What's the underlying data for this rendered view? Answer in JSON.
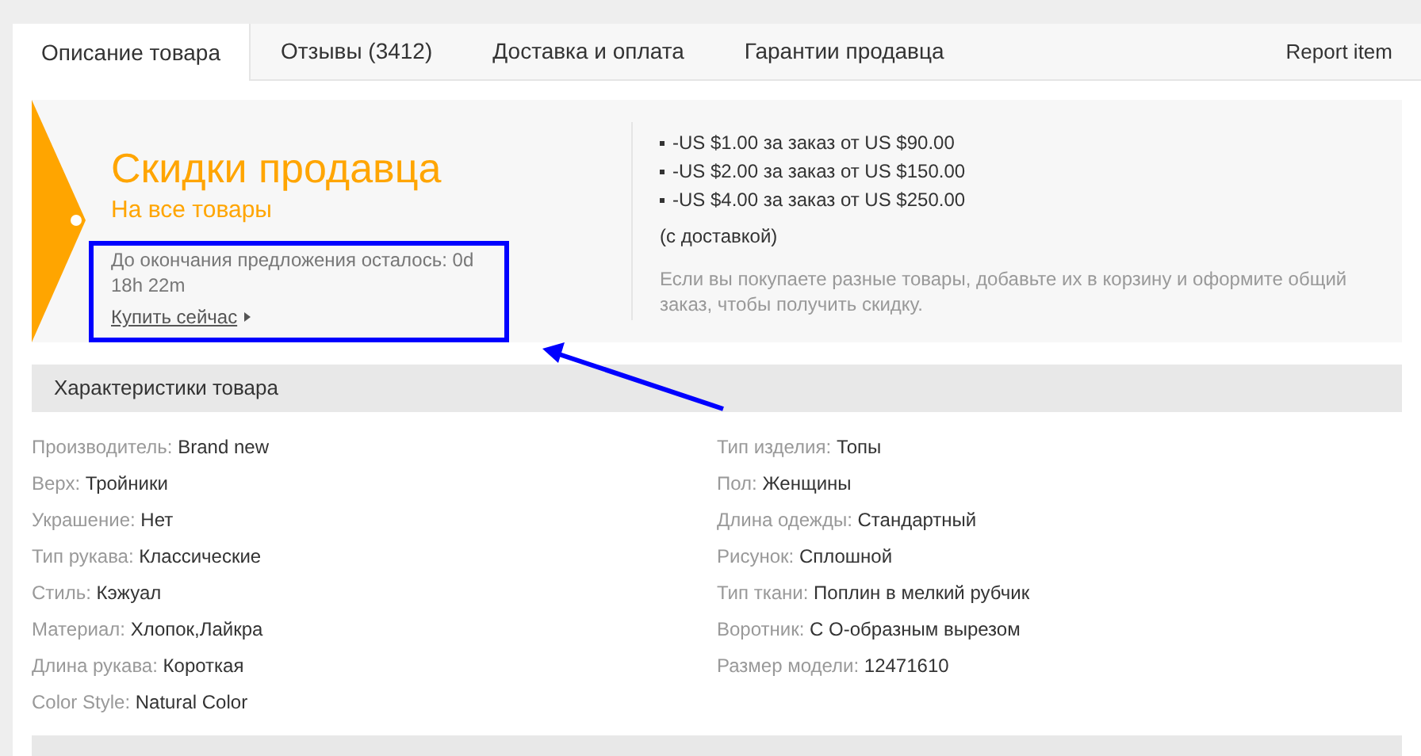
{
  "tabs": [
    {
      "label": "Описание товара",
      "selected": true
    },
    {
      "label": "Отзывы (3412)",
      "selected": false
    },
    {
      "label": "Доставка и оплата",
      "selected": false
    },
    {
      "label": "Гарантии продавца",
      "selected": false
    }
  ],
  "report_link": "Report item",
  "promo": {
    "title": "Скидки продавца",
    "subtitle": "На все товары",
    "countdown": "До окончания предложения осталось: 0d 18h 22m",
    "buy_link": "Купить сейчас",
    "discounts": [
      "-US $1.00 за заказ от US $90.00",
      "-US $2.00 за заказ от US $150.00",
      "-US $4.00 за заказ от US $250.00"
    ],
    "shipping_note": "(с доставкой)",
    "hint": "Если вы покупаете разные товары, добавьте их в корзину и оформите общий заказ, чтобы получить скидку."
  },
  "specs": {
    "heading": "Характеристики товара",
    "left": [
      {
        "label": "Производитель:",
        "value": "Brand new"
      },
      {
        "label": "Верх:",
        "value": "Тройники"
      },
      {
        "label": "Украшение:",
        "value": "Нет"
      },
      {
        "label": "Тип рукава:",
        "value": "Классические"
      },
      {
        "label": "Стиль:",
        "value": "Кэжуал"
      },
      {
        "label": "Материал:",
        "value": "Хлопок,Лайкра"
      },
      {
        "label": "Длина рукава:",
        "value": "Короткая"
      },
      {
        "label": "Color Style:",
        "value": "Natural Color"
      }
    ],
    "right": [
      {
        "label": "Тип изделия:",
        "value": "Топы"
      },
      {
        "label": "Пол:",
        "value": "Женщины"
      },
      {
        "label": "Длина одежды:",
        "value": "Стандартный"
      },
      {
        "label": "Рисунок:",
        "value": "Сплошной"
      },
      {
        "label": "Тип ткани:",
        "value": "Поплин в мелкий рубчик"
      },
      {
        "label": "Воротник:",
        "value": "С О-образным вырезом"
      },
      {
        "label": "Размер модели:",
        "value": "12471610"
      }
    ]
  }
}
